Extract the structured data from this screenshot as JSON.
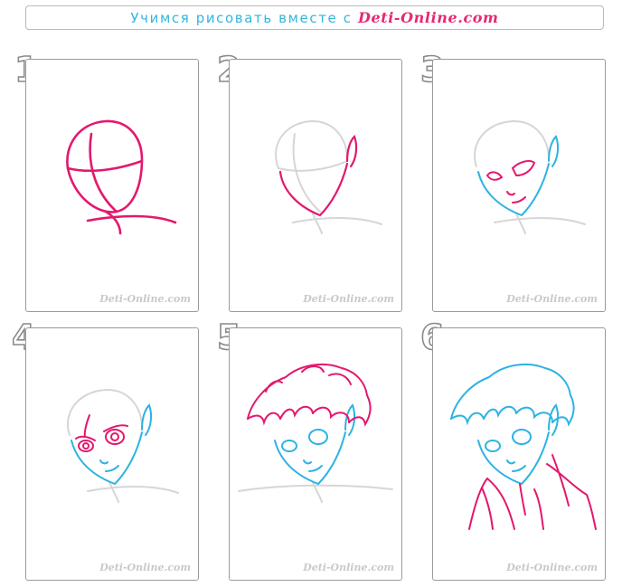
{
  "header": {
    "title_prefix": "Учимся рисовать вместе с ",
    "title_brand": "Deti-Online.com"
  },
  "colors": {
    "new_line": "#e3186e",
    "previous_line": "#2db3e3",
    "guide_line": "#d6d6d6",
    "header_text": "#33b6dd"
  },
  "steps": [
    {
      "number": "1",
      "watermark": "Deti-Online.com"
    },
    {
      "number": "2",
      "watermark": "Deti-Online.com"
    },
    {
      "number": "3",
      "watermark": "Deti-Online.com"
    },
    {
      "number": "4",
      "watermark": "Deti-Online.com"
    },
    {
      "number": "5",
      "watermark": "Deti-Online.com"
    },
    {
      "number": "6",
      "watermark": "Deti-Online.com"
    }
  ]
}
